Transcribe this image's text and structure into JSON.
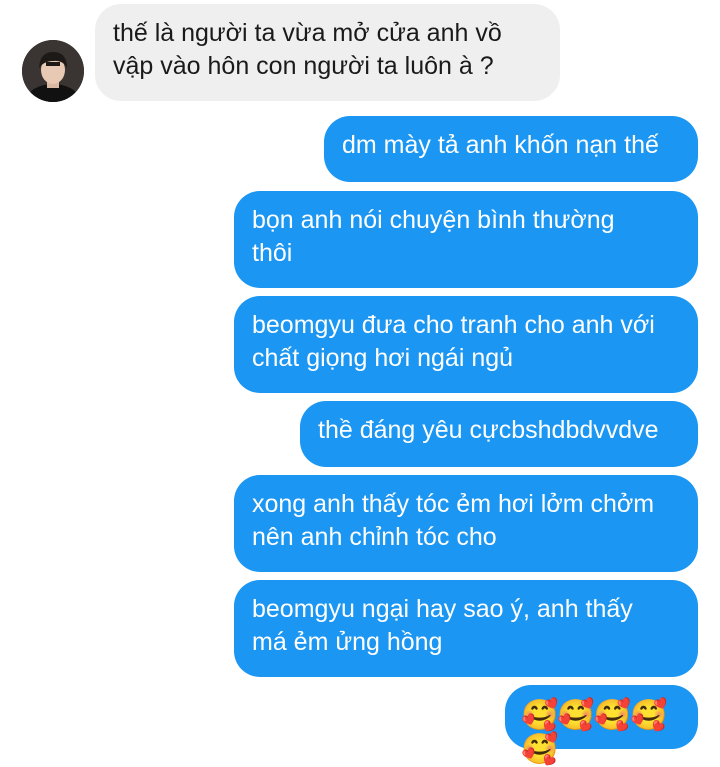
{
  "contact": {
    "avatar_icon": "profile-avatar"
  },
  "colors": {
    "sent_bubble": "#1b96f2",
    "received_bubble": "#efefef"
  },
  "messages": [
    {
      "direction": "received",
      "text": "thế là người ta vừa mở cửa anh vồ\nvập vào hôn con người ta luôn à ?"
    },
    {
      "direction": "sent",
      "text": "dm mày tả anh khốn nạn thế"
    },
    {
      "direction": "sent",
      "text": "bọn anh nói chuyện bình thường\nthôi"
    },
    {
      "direction": "sent",
      "text": "beomgyu đưa cho tranh cho anh với\nchất giọng hơi ngái ngủ"
    },
    {
      "direction": "sent",
      "text": "thề đáng yêu cựcbshdbdvvdve"
    },
    {
      "direction": "sent",
      "text": "xong anh thấy tóc ẻm hơi lởm chởm\nnên anh chỉnh tóc cho"
    },
    {
      "direction": "sent",
      "text": "beomgyu ngại hay sao ý, anh thấy\nmá ẻm ửng hồng"
    },
    {
      "direction": "sent",
      "text": "🥰🥰🥰🥰🥰"
    }
  ]
}
